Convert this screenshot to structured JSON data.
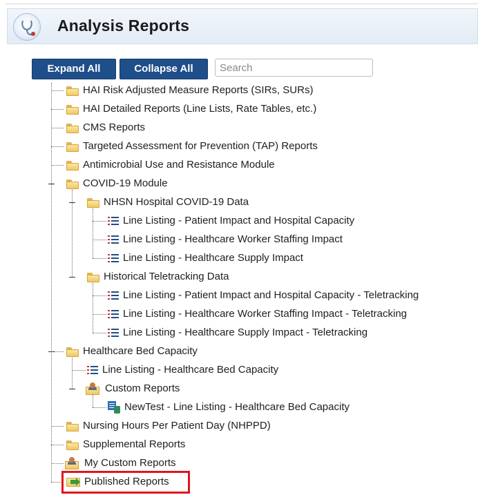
{
  "header": {
    "title": "Analysis Reports",
    "icon": "stethoscope-icon"
  },
  "toolbar": {
    "expand_label": "Expand All",
    "collapse_label": "Collapse All",
    "search_placeholder": "Search"
  },
  "tree": {
    "hai_risk": "HAI Risk Adjusted Measure Reports (SIRs, SURs)",
    "hai_detailed": "HAI Detailed Reports (Line Lists, Rate Tables, etc.)",
    "cms": "CMS Reports",
    "tap": "Targeted Assessment for Prevention (TAP) Reports",
    "antimicrobial": "Antimicrobial Use and Resistance Module",
    "covid": "COVID-19 Module",
    "nhsn_covid": "NHSN Hospital COVID-19 Data",
    "ll_patient": "Line Listing - Patient Impact and Hospital Capacity",
    "ll_worker": "Line Listing - Healthcare Worker Staffing Impact",
    "ll_supply": "Line Listing - Healthcare Supply Impact",
    "historical": "Historical Teletracking Data",
    "ll_patient_tt": "Line Listing - Patient Impact and Hospital Capacity - Teletracking",
    "ll_worker_tt": "Line Listing - Healthcare Worker Staffing Impact - Teletracking",
    "ll_supply_tt": "Line Listing - Healthcare Supply Impact - Teletracking",
    "bed_capacity": "Healthcare Bed Capacity",
    "ll_bed": "Line Listing - Healthcare Bed Capacity",
    "custom_reports": "Custom Reports",
    "newtest": "NewTest - Line Listing - Healthcare Bed Capacity",
    "nhppd": "Nursing Hours Per Patient Day (NHPPD)",
    "supplemental": "Supplemental Reports",
    "my_custom": "My Custom Reports",
    "published": "Published Reports"
  },
  "colors": {
    "button_bg": "#1f4f8a",
    "highlight_border": "#e0141c"
  }
}
